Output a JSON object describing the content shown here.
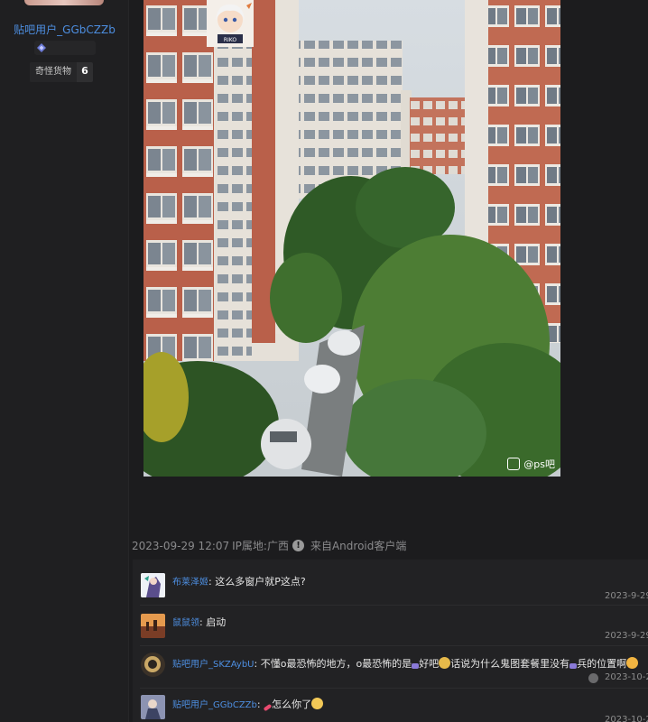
{
  "sidebar": {
    "username": "贴吧用户_GGbCZZb",
    "forum_tag": {
      "name": "奇怪货物",
      "level": "6"
    }
  },
  "post": {
    "image": {
      "description_icon": "photo-of-apartment-buildings",
      "watermark_text": "@ps吧"
    },
    "sticker_label": "RIKO",
    "meta": {
      "date": "2023-09-29 12:07",
      "ip_label": "IP属地:广西",
      "source": "来自Android客户端"
    }
  },
  "comments": [
    {
      "user": "布莱泽姬",
      "text": "这么多窗户就P这点?",
      "time": "2023-9-29"
    },
    {
      "user": "鼠鼠领",
      "text": "启动",
      "time": "2023-9-29"
    },
    {
      "user": "贴吧用户_SKZAybU",
      "text_parts": [
        "不懂o最恐怖的地方，o最恐怖的是",
        "好吧",
        "话说为什么鬼图套餐里没有",
        "兵的位置啊"
      ],
      "time": "2023-10-2"
    },
    {
      "user": "贴吧用户_GGbCZZb",
      "text": "怎么你了",
      "time": "2023-10-2"
    }
  ],
  "colors": {
    "background": "#1c1c1e",
    "username": "#4d8ee0",
    "meta": "#8a8a8c"
  }
}
